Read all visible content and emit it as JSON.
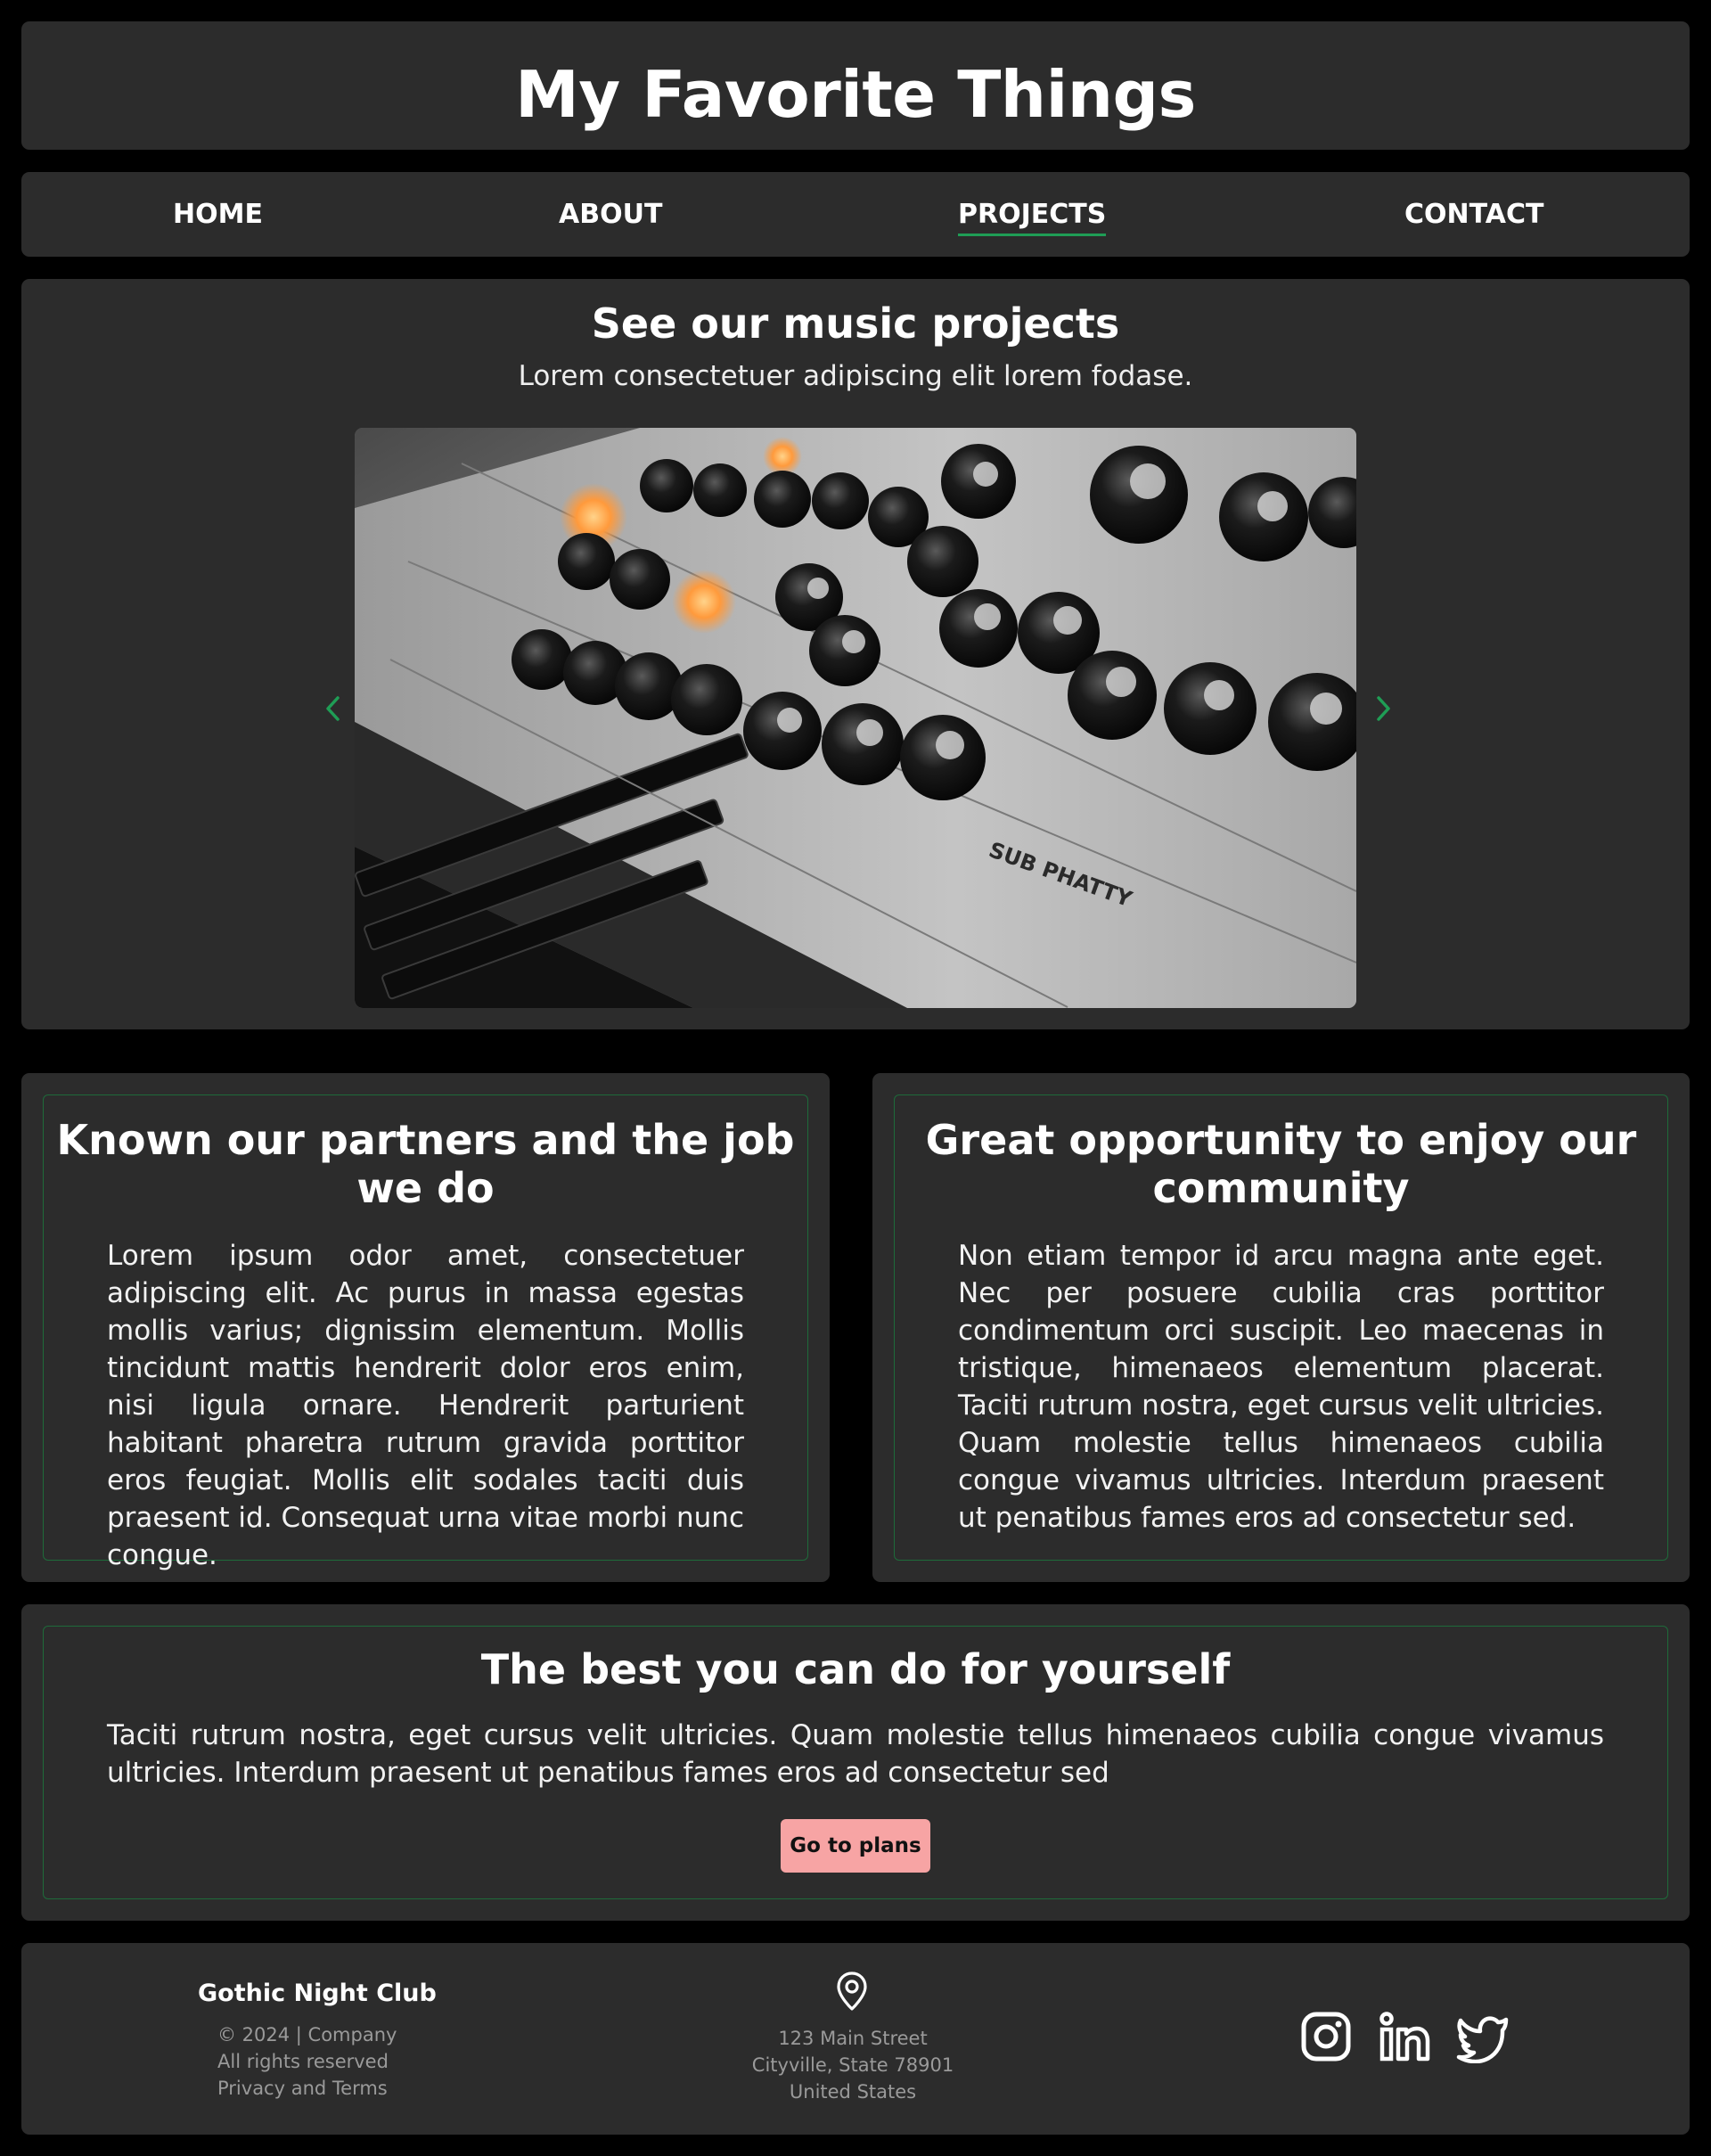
{
  "header": {
    "title": "My Favorite Things"
  },
  "nav": {
    "items": [
      "HOME",
      "ABOUT",
      "PROJECTS",
      "CONTACT"
    ],
    "active": "PROJECTS",
    "active_color": "#1f9d55"
  },
  "hero": {
    "title": "See our music projects",
    "subtitle": "Lorem consectetuer adipiscing elit lorem fodase.",
    "carousel": {
      "prev_icon": "chevron-left-icon",
      "next_icon": "chevron-right-icon",
      "slide": "synthesizer-photo"
    }
  },
  "cards": [
    {
      "title": "Known our partners and the job we do",
      "body": "Lorem ipsum odor amet, consectetuer adipiscing elit. Ac purus in massa egestas mollis varius; dignissim elementum. Mollis tincidunt mattis hendrerit dolor eros enim, nisi ligula ornare. Hendrerit parturient habitant pharetra rutrum gravida porttitor eros feugiat. Mollis elit sodales taciti duis praesent id. Consequat urna vitae morbi nunc congue."
    },
    {
      "title": "Great opportunity to enjoy our community",
      "body": "Non etiam tempor id arcu magna ante eget. Nec per posuere cubilia cras porttitor condimentum orci suscipit. Leo maecenas in tristique, himenaeos elementum placerat. Taciti rutrum nostra, eget cursus velit ultricies. Quam molestie tellus himenaeos cubilia congue vivamus ultricies. Interdum praesent ut penatibus fames eros ad consectetur sed."
    }
  ],
  "best": {
    "title": "The best you can do for yourself",
    "body": "Taciti rutrum nostra, eget cursus velit ultricies. Quam molestie tellus himenaeos cubilia congue vivamus ultricies. Interdum praesent ut penatibus fames eros ad consectetur sed",
    "button_label": "Go to plans",
    "button_color": "#f7a4a4"
  },
  "footer": {
    "brand": "Gothic Night Club",
    "copyright": "© 2024 | Company",
    "rights": "All rights reserved",
    "terms": "Privacy and Terms",
    "location_icon": "map-pin-icon",
    "address": [
      "123 Main Street",
      "Cityville, State 78901",
      "United States"
    ],
    "social": [
      "instagram-icon",
      "linkedin-icon",
      "twitter-icon"
    ]
  },
  "colors": {
    "background": "#000000",
    "panel": "#2c2c2c",
    "accent": "#1f9d55",
    "border": "#1e6b3a"
  }
}
